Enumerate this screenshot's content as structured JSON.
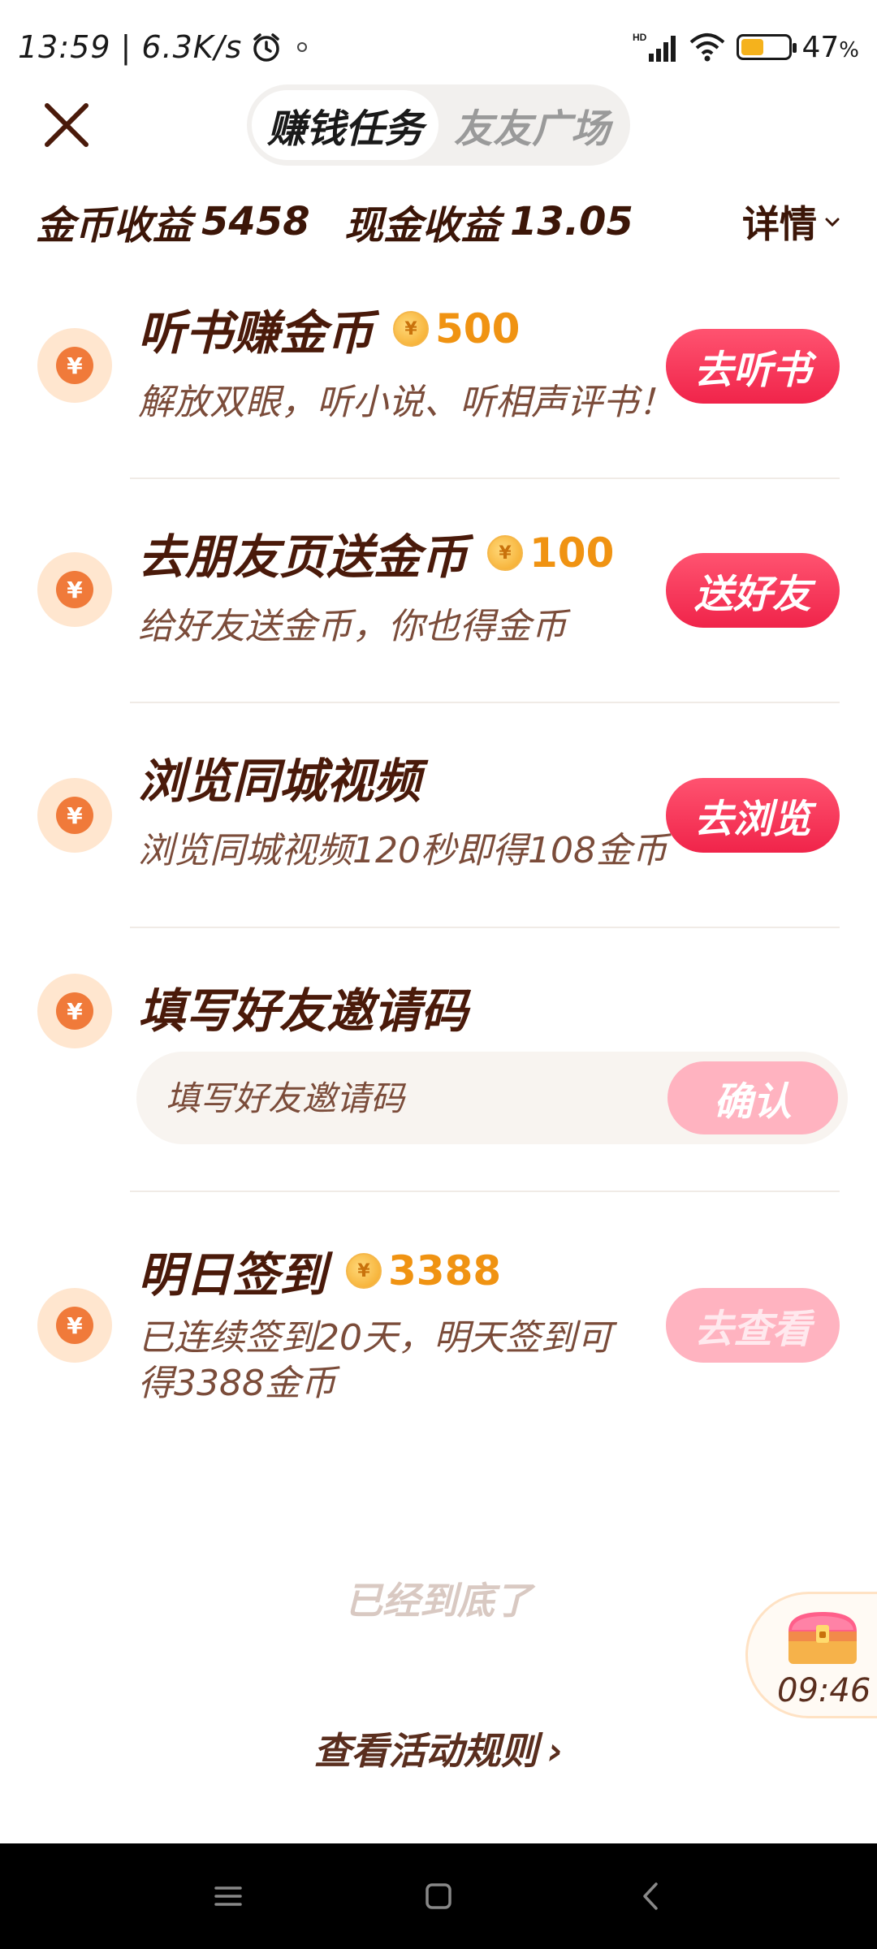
{
  "status_bar": {
    "time": "13:59",
    "speed": "6.3K/s",
    "battery": "47",
    "battery_unit": "%",
    "battery_level": 0.47,
    "network_label": "HD"
  },
  "header": {
    "tabs": [
      {
        "label": "赚钱任务",
        "active": true
      },
      {
        "label": "友友广场",
        "active": false
      }
    ]
  },
  "earnings": {
    "coins_label": "金币收益",
    "coins_value": "5458",
    "cash_label": "现金收益",
    "cash_value": "13.05",
    "details_label": "详情"
  },
  "tasks": [
    {
      "title": "听书赚金币",
      "reward": "500",
      "desc": "解放双眼，听小说、听相声评书！",
      "button": "去听书"
    },
    {
      "title": "去朋友页送金币",
      "reward": "100",
      "desc": "给好友送金币，你也得金币",
      "button": "送好友"
    },
    {
      "title": "浏览同城视频",
      "desc": "浏览同城视频120秒即得108金币",
      "button": "去浏览"
    },
    {
      "title": "填写好友邀请码",
      "placeholder": "填写好友邀请码",
      "button": "确认"
    },
    {
      "title": "明日签到",
      "reward": "3388",
      "desc": "已连续签到20天，明天签到可得3388金币",
      "button": "去查看"
    }
  ],
  "coin_symbol": "¥",
  "footer": {
    "end_text": "已经到底了",
    "rules_text": "查看活动规则",
    "rules_arrow": "›"
  },
  "chest": {
    "timer": "09:46"
  },
  "colors": {
    "accent": "#f0244a",
    "reward": "#f09312",
    "text": "#4a1a0a"
  }
}
